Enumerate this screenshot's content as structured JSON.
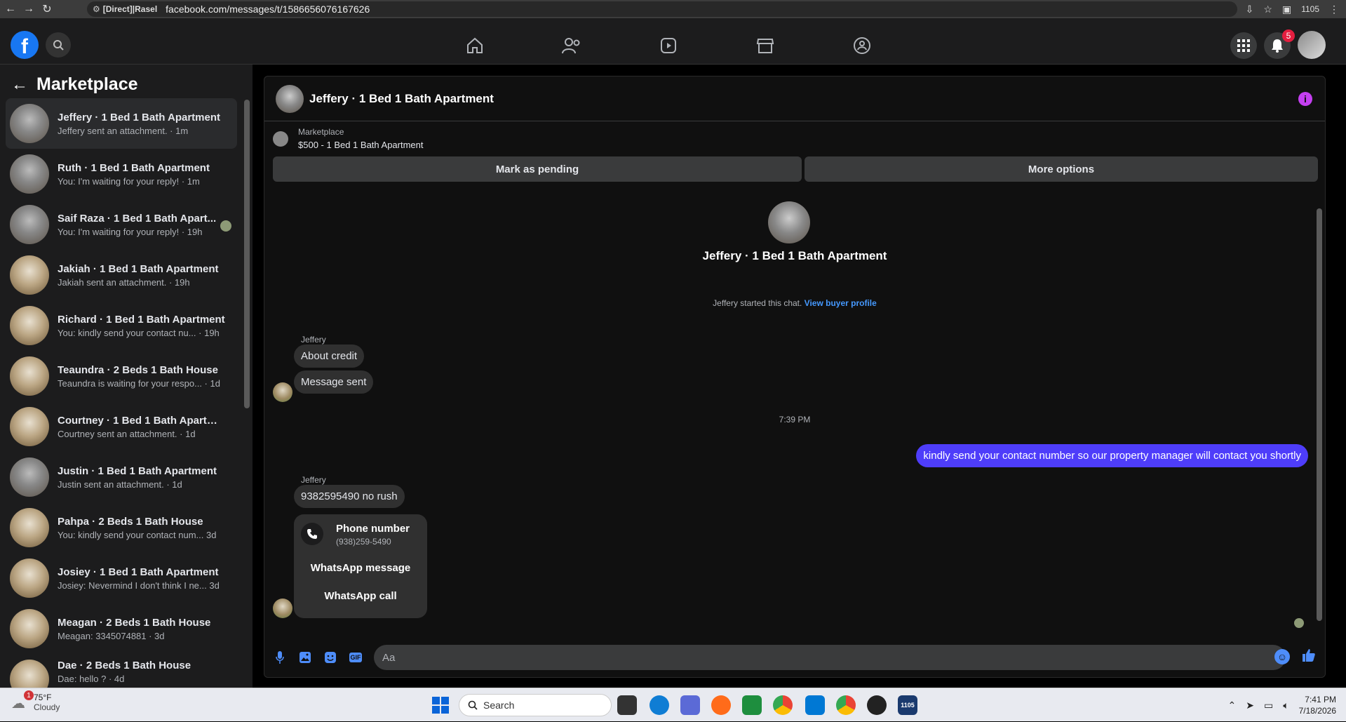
{
  "browser": {
    "profile_label": "[Direct]|Rasel",
    "url": "facebook.com/messages/t/1586656076167626",
    "counter": "1105"
  },
  "topnav": {
    "notification_count": "5"
  },
  "sidebar": {
    "title": "Marketplace",
    "conversations": [
      {
        "name": "Jeffery · 1 Bed 1 Bath Apartment",
        "preview": "Jeffery sent an attachment. · 1m"
      },
      {
        "name": "Ruth · 1 Bed 1 Bath Apartment",
        "preview": "You: I'm waiting for your reply! · 1m"
      },
      {
        "name": "Saif Raza · 1 Bed 1 Bath Apart...",
        "preview": "You: I'm waiting for your reply! · 19h"
      },
      {
        "name": "Jakiah · 1 Bed 1 Bath Apartment",
        "preview": "Jakiah sent an attachment. · 19h"
      },
      {
        "name": "Richard · 1 Bed 1 Bath Apartment",
        "preview": "You: kindly send your contact nu...   · 19h"
      },
      {
        "name": "Teaundra · 2 Beds 1 Bath House",
        "preview": "Teaundra is waiting for your respo...   · 1d"
      },
      {
        "name": "Courtney · 1 Bed 1 Bath Apartme...",
        "preview": "Courtney sent an attachment. · 1d"
      },
      {
        "name": "Justin · 1 Bed 1 Bath Apartment",
        "preview": "Justin sent an attachment. · 1d"
      },
      {
        "name": "Pahpa · 2 Beds 1 Bath House",
        "preview": "You: kindly send your contact num...   3d"
      },
      {
        "name": "Josiey · 1 Bed 1 Bath Apartment",
        "preview": "Josiey: Nevermind I don't think I ne...   3d"
      },
      {
        "name": "Meagan · 2 Beds 1 Bath House",
        "preview": "Meagan: 3345074881 · 3d"
      },
      {
        "name": "Dae · 2 Beds 1 Bath House",
        "preview": "Dae: hello ? · 4d"
      }
    ]
  },
  "chat": {
    "header_title": "Jeffery · 1 Bed 1 Bath Apartment",
    "listing_label": "Marketplace",
    "listing_title": "$500 - 1 Bed 1 Bath Apartment",
    "mark_pending": "Mark as pending",
    "more_options": "More options",
    "center_title": "Jeffery · 1 Bed 1 Bath Apartment",
    "started_text": "Jeffery started this chat.",
    "view_profile": "View buyer profile",
    "sender1": "Jeffery",
    "msg1": "About credit",
    "msg2": "Message sent",
    "timestamp": "7:39 PM",
    "outgoing": "kindly send your contact number so our property manager will contact you shortly",
    "sender2": "Jeffery",
    "msg3": "9382595490 no rush",
    "card_title": "Phone number",
    "card_phone": "(938)259-5490",
    "card_whatsapp_msg": "WhatsApp message",
    "card_whatsapp_call": "WhatsApp call",
    "composer_placeholder": "Aa",
    "gif_label": "GIF"
  },
  "taskbar": {
    "weather_badge": "1",
    "temp": "75°F",
    "condition": "Cloudy",
    "search_label": "Search",
    "time": "7:41 PM",
    "date": "7/18/2026",
    "app_badge": "1105"
  }
}
